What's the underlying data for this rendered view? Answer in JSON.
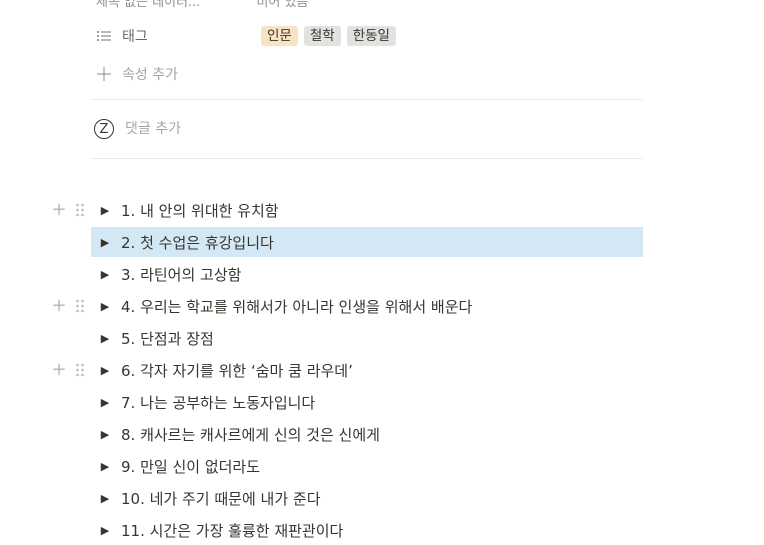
{
  "properties": {
    "cut_row": {
      "name": "제목 없는 데이터...",
      "value": "비어 있음"
    },
    "tags_row": {
      "name": "태그",
      "tags": [
        {
          "label": "인문",
          "color": "#fae3c2"
        },
        {
          "label": "철학",
          "color": "#e3e2e0"
        },
        {
          "label": "한동일",
          "color": "#e3e2e0"
        }
      ]
    },
    "add_property_label": "속성 추가"
  },
  "comment": {
    "avatar_letter": "Z",
    "placeholder": "댓글 추가"
  },
  "toggles": [
    {
      "label": "1. 내 안의 위대한 유치함",
      "handle": true,
      "selected": false
    },
    {
      "label": "2. 첫 수업은 휴강입니다",
      "handle": false,
      "selected": true
    },
    {
      "label": "3. 라틴어의 고상함",
      "handle": false,
      "selected": false
    },
    {
      "label": "4. 우리는 학교를 위해서가 아니라 인생을 위해서 배운다",
      "handle": true,
      "selected": false
    },
    {
      "label": "5. 단점과 장점",
      "handle": false,
      "selected": false
    },
    {
      "label": "6. 각자 자기를 위한 ‘숨마 쿰 라우데’",
      "handle": true,
      "selected": false
    },
    {
      "label": "7. 나는 공부하는 노동자입니다",
      "handle": false,
      "selected": false
    },
    {
      "label": "8. 캐사르는 캐사르에게 신의 것은 신에게",
      "handle": false,
      "selected": false
    },
    {
      "label": "9. 만일 신이 없더라도",
      "handle": false,
      "selected": false
    },
    {
      "label": "10. 네가 주기 때문에 내가 준다",
      "handle": false,
      "selected": false
    },
    {
      "label": "11. 시간은 가장 훌륭한 재판관이다",
      "handle": false,
      "selected": false
    }
  ],
  "colors": {
    "selected_bg": "#d3e8f4",
    "text": "#37352f"
  }
}
